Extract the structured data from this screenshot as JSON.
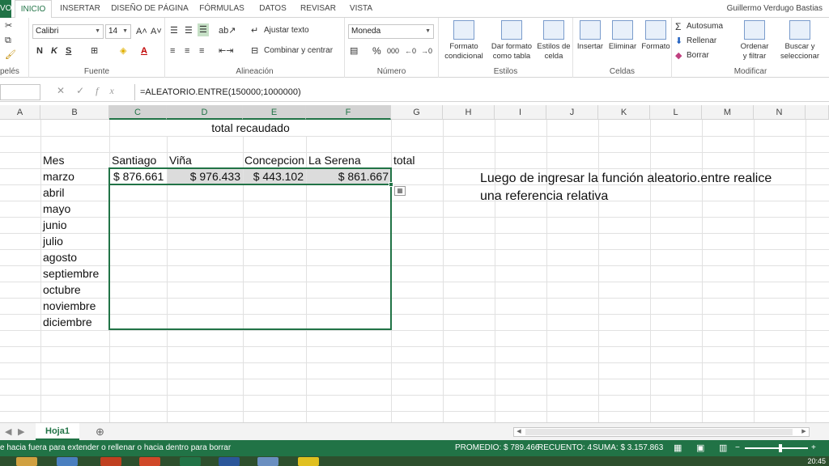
{
  "ribbon_tabs": {
    "file": "VO",
    "items": [
      "INICIO",
      "INSERTAR",
      "DISEÑO DE PÁGINA",
      "FÓRMULAS",
      "DATOS",
      "REVISAR",
      "VISTA"
    ],
    "active": "INICIO"
  },
  "user_name": "Guillermo Verdugo Bastias",
  "ribbon": {
    "groups": {
      "clipboard": "pelés",
      "font": "Fuente",
      "alignment": "Alineación",
      "number": "Número",
      "styles": "Estilos",
      "cells": "Celdas",
      "editing": "Modificar"
    },
    "font_name": "Calibri",
    "font_size": "14",
    "bold": "N",
    "italic": "K",
    "underline": "S",
    "wrap_text": "Ajustar texto",
    "merge_center": "Combinar y centrar",
    "number_format": "Moneda",
    "percent": "%",
    "thousands": "000",
    "cond_format": [
      "Formato",
      "condicional"
    ],
    "format_table": [
      "Dar formato",
      "como tabla"
    ],
    "cell_styles": [
      "Estilos de",
      "celda"
    ],
    "insert": "Insertar",
    "delete": "Eliminar",
    "format": "Formato",
    "autosum": "Autosuma",
    "fill": "Rellenar",
    "clear": "Borrar",
    "sort": [
      "Ordenar",
      "y filtrar"
    ],
    "find": [
      "Buscar y",
      "seleccionar"
    ]
  },
  "formula_bar": {
    "name_box": "",
    "fx": "fx",
    "formula": "=ALEATORIO.ENTRE(150000;1000000)"
  },
  "columns": [
    "A",
    "B",
    "C",
    "D",
    "E",
    "F",
    "G",
    "H",
    "I",
    "J",
    "K",
    "L",
    "M",
    "N"
  ],
  "sheet": {
    "title": "total recaudado",
    "header_row": [
      "Mes",
      "Santiago",
      "Viña",
      "Concepcion",
      "La Serena",
      "total"
    ],
    "months": [
      "marzo",
      "abril",
      "mayo",
      "junio",
      "julio",
      "agosto",
      "septiembre",
      "octubre",
      "noviembre",
      "diciembre"
    ],
    "march_values": [
      "$ 876.661",
      "$ 976.433",
      "$ 443.102",
      "$ 861.667"
    ],
    "note_line1": "Luego de ingresar la función aleatorio.entre realice",
    "note_line2": "una referencia relativa"
  },
  "sheet_tab": "Hoja1",
  "status": {
    "message": "e hacia fuera para extender o rellenar o hacia dentro para borrar",
    "average": "PROMEDIO: $ 789.466",
    "count": "RECUENTO: 4",
    "sum": "SUMA: $ 3.157.863"
  },
  "clock": "20:45",
  "colors": {
    "accent": "#217346",
    "selection": "#dcdcdc"
  }
}
